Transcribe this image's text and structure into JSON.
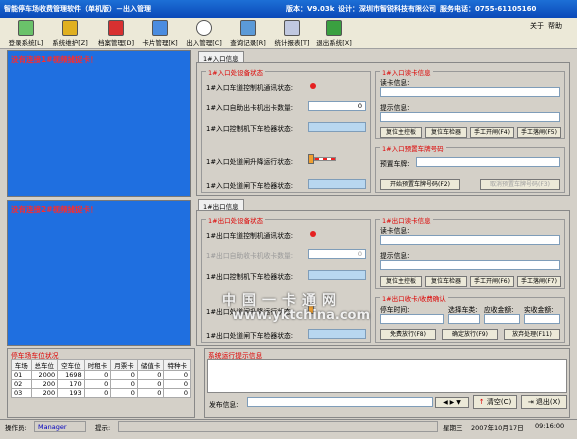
{
  "titlebar": {
    "app_title": "智能停车场收费管理软件（单机版）－出入管理",
    "version": "版本：V9.03k",
    "designer": "设计：深圳市智锐科技有限公司",
    "hotline": "服务电话：0755-61105160"
  },
  "menu": {
    "about": "关于",
    "help": "帮助"
  },
  "toolbar": [
    {
      "label": "登录系统[L]",
      "icon": "login-icon"
    },
    {
      "label": "系统维护[Z]",
      "icon": "maintenance-icon"
    },
    {
      "label": "档案管理[D]",
      "icon": "archive-icon"
    },
    {
      "label": "卡片管理[K]",
      "icon": "card-icon"
    },
    {
      "label": "出入管理[C]",
      "icon": "eye-icon"
    },
    {
      "label": "查询记录[R]",
      "icon": "query-icon"
    },
    {
      "label": "统计报表[T]",
      "icon": "report-icon"
    },
    {
      "label": "退出系统[X]",
      "icon": "exit-icon"
    }
  ],
  "video": {
    "cam1": "没有连接1#视频捕捉卡！",
    "cam2": "没有连接2#视频捕捉卡！"
  },
  "entry": {
    "tab": "1#入口信息",
    "device_group": "1#入口处设备状态",
    "reader_comm": "1#入口车道控制机通讯状态:",
    "card_count": "1#入口自助出卡机出卡数量:",
    "card_count_value": "0",
    "loop_detector": "1#入口控制机下车检器状态:",
    "barrier_status": "1#入口处道闸升降运行状态:",
    "barrier_detector": "1#入口处道闸下车检器状态:",
    "card_group": "1#入口读卡信息",
    "read_info": "读卡信息:",
    "prompt_info": "提示信息:",
    "buttons": [
      "复位主控板",
      "复位车检器",
      "手工开闸(F4)",
      "手工落闸(F5)"
    ],
    "plate_group": "1#入口预置车牌号码",
    "preset_plate": "预置车牌:",
    "start_preset": "开始预置车牌号码(F2)",
    "cancel_preset": "取消预置车牌号码(F3)"
  },
  "exit": {
    "tab": "1#出口信息",
    "device_group": "1#出口处设备状态",
    "reader_comm": "1#出口车道控制机通讯状态:",
    "card_count": "1#出口自助收卡机收卡数量:",
    "card_count_value": "0",
    "loop_detector": "1#出口控制机下车检器状态:",
    "barrier_status": "1#出口处道闸升降运行状态:",
    "barrier_detector": "1#出口处道闸下车检器状态:",
    "card_group": "1#出口读卡信息",
    "read_info": "读卡信息:",
    "prompt_info": "提示信息:",
    "buttons": [
      "复位主控板",
      "复位车检器",
      "手工开闸(F6)",
      "手工落闸(F7)"
    ],
    "fee_group": "1#出口收卡/收费确认",
    "stop_time": "停车时间:",
    "vehicle_type": "选择车类:",
    "due": "应收金额:",
    "paid": "实收金额:",
    "fee_buttons": [
      "免费放行(F8)",
      "确定放行(F9)",
      "放弃处理(F11)"
    ]
  },
  "slots": {
    "title": "停车场车位状况",
    "headers": [
      "车场",
      "总车位",
      "空车位",
      "时租卡",
      "月票卡",
      "储值卡",
      "特种卡"
    ],
    "rows": [
      [
        "01",
        "2000",
        "1698",
        "0",
        "0",
        "0",
        "0"
      ],
      [
        "02",
        "200",
        "170",
        "0",
        "0",
        "0",
        "0"
      ],
      [
        "03",
        "200",
        "193",
        "0",
        "0",
        "0",
        "0"
      ]
    ]
  },
  "log": {
    "title": "系统运行提示信息"
  },
  "publish": {
    "label": "发布信息:",
    "clear": "清空(C)",
    "exit": "退出(X)"
  },
  "status": {
    "operator_label": "操作员:",
    "operator": "Manager",
    "hint_label": "提示:",
    "weekday": "星期三",
    "date": "2007年10月17日",
    "time": "09:16:00"
  },
  "watermark": {
    "cn": "中国一卡通网",
    "url": "www.yktchina.com"
  }
}
